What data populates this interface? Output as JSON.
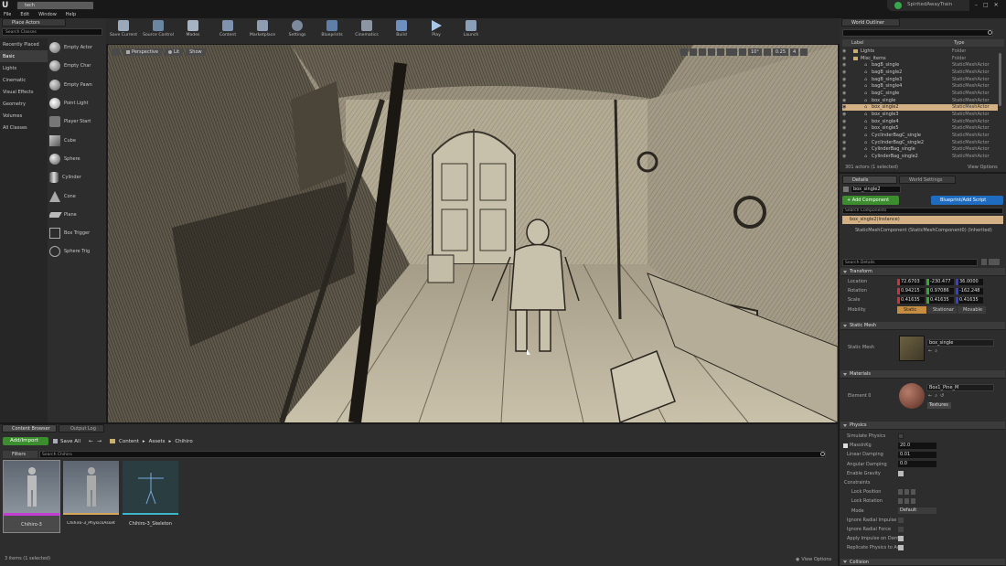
{
  "app": {
    "project_name": "SpiritedAwayTrain",
    "tab": "tech"
  },
  "menu": [
    "File",
    "Edit",
    "Window",
    "Help"
  ],
  "place_actors": {
    "tab": "Place Actors",
    "search_placeholder": "Search Classes",
    "categories": [
      "Recently Placed",
      "Basic",
      "Lights",
      "Cinematic",
      "Visual Effects",
      "Geometry",
      "Volumes",
      "All Classes"
    ],
    "items": [
      "Empty Actor",
      "Empty Char",
      "Empty Pawn",
      "Point Light",
      "Player Start",
      "Cube",
      "Sphere",
      "Cylinder",
      "Cone",
      "Plane",
      "Box Trigger",
      "Sphere Trig"
    ]
  },
  "toolbar": [
    "Save Current",
    "Source Control",
    "Modes",
    "Content",
    "Marketplace",
    "Settings",
    "Blueprints",
    "Cinematics",
    "Build",
    "Play",
    "Launch"
  ],
  "viewport": {
    "perspective": "Perspective",
    "lit": "Lit",
    "show": "Show",
    "angle": "10°",
    "speed": "0.25",
    "cam": "4"
  },
  "outliner": {
    "tab": "World Outliner",
    "col_label": "Label",
    "col_type": "Type",
    "rows": [
      {
        "label": "Lights",
        "type": "Folder"
      },
      {
        "label": "Misc_Items",
        "type": "Folder"
      },
      {
        "label": "bagB_single",
        "type": "StaticMeshActor"
      },
      {
        "label": "bagB_single2",
        "type": "StaticMeshActor"
      },
      {
        "label": "bagB_single3",
        "type": "StaticMeshActor"
      },
      {
        "label": "bagB_single4",
        "type": "StaticMeshActor"
      },
      {
        "label": "bagC_single",
        "type": "StaticMeshActor"
      },
      {
        "label": "box_single",
        "type": "StaticMeshActor"
      },
      {
        "label": "box_single2",
        "type": "StaticMeshActor"
      },
      {
        "label": "box_single3",
        "type": "StaticMeshActor"
      },
      {
        "label": "box_single4",
        "type": "StaticMeshActor"
      },
      {
        "label": "box_single5",
        "type": "StaticMeshActor"
      },
      {
        "label": "CyclinderBagC_single",
        "type": "StaticMeshActor"
      },
      {
        "label": "CyclinderBagC_single2",
        "type": "StaticMeshActor"
      },
      {
        "label": "CylinderBag_single",
        "type": "StaticMeshActor"
      },
      {
        "label": "CylinderBag_single2",
        "type": "StaticMeshActor"
      }
    ],
    "status": "301 actors (1 selected)",
    "view_options": "View Options"
  },
  "details": {
    "tab_details": "Details",
    "tab_world": "World Settings",
    "name_value": "box_single2",
    "add_component": "+ Add Component",
    "blueprint": "Blueprint/Add Script",
    "search_components": "Search Components",
    "component_root": "box_single2(Instance)",
    "component_child": "StaticMeshComponent (StaticMeshComponent0) (Inherited)",
    "search_details": "Search Details",
    "transform_title": "Transform",
    "location_label": "Location",
    "location": [
      "72.6703",
      "-230.477",
      "36.0000"
    ],
    "rotation_label": "Rotation",
    "rotation": [
      "0.94215",
      "0.97086",
      "-162.248"
    ],
    "scale_label": "Scale",
    "scale": [
      "0.41635",
      "0.41635",
      "0.41635"
    ],
    "mobility_label": "Mobility",
    "mobility": [
      "Static",
      "Stationar",
      "Movable"
    ],
    "static_mesh_title": "Static Mesh",
    "static_mesh_label": "Static Mesh",
    "static_mesh_value": "box_single",
    "materials_title": "Materials",
    "element_label": "Element 0",
    "material_value": "Box1_Pine_M",
    "textures": "Textures",
    "physics_title": "Physics",
    "physics_rows": [
      "Simulate Physics",
      "MassInKg",
      "Linear Damping",
      "Angular Damping",
      "Enable Gravity",
      "Constraints",
      "Lock Position",
      "Lock Rotation",
      "Mode",
      "Ignore Radial Impulse",
      "Ignore Radial Force",
      "Apply Impulse on Damage",
      "Replicate Physics to Auton"
    ],
    "mass": "20.0",
    "linear_damping": "0.01",
    "angular_damping": "0.0",
    "mode_value": "Default",
    "collision_title": "Collision"
  },
  "content_browser": {
    "tab": "Content Browser",
    "tab2": "Output Log",
    "add_import": "Add/Import",
    "save_all": "Save All",
    "path": [
      "Content",
      "Assets",
      "Chihiro"
    ],
    "filters": "Filters",
    "search_placeholder": "Search Chihiro",
    "assets": [
      "Chihiro-3",
      "Chihiro-3_PhysicsAsset",
      "Chihiro-3_Skeleton"
    ],
    "status": "3 items (1 selected)",
    "view_options": "View Options"
  },
  "colors": {
    "accent_orange": "#c68c3f",
    "selection": "#d4b184",
    "green_btn": "#3b8d2e",
    "blue_btn": "#1f6bbf",
    "panel": "#2d2d2d"
  }
}
